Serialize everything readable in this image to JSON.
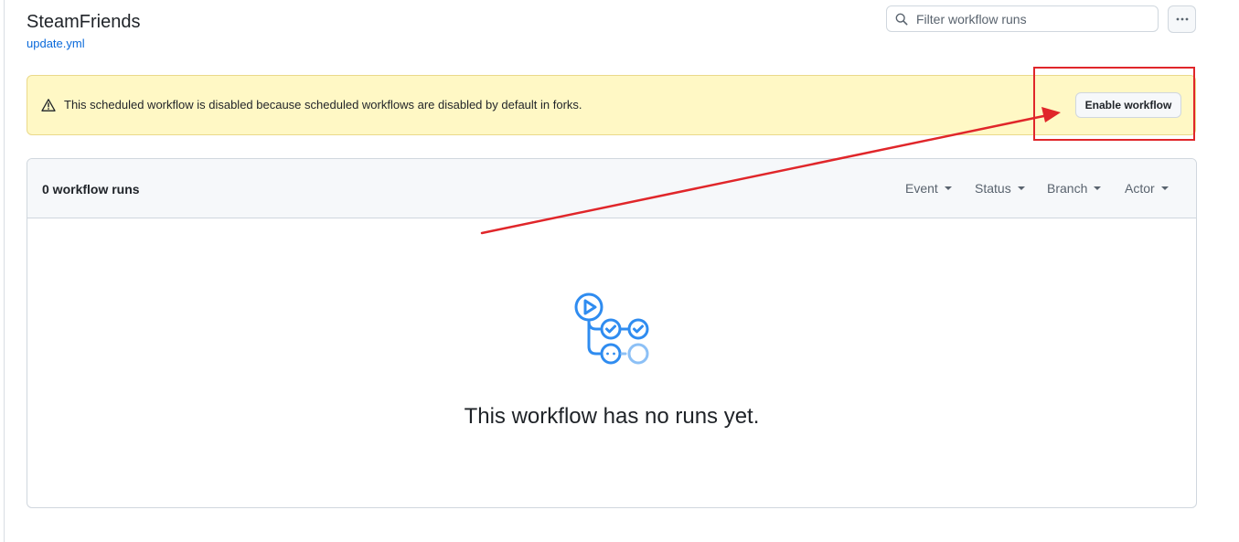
{
  "header": {
    "title": "SteamFriends",
    "file_link": "update.yml"
  },
  "filter": {
    "placeholder": "Filter workflow runs"
  },
  "banner": {
    "message": "This scheduled workflow is disabled because scheduled workflows are disabled by default in forks.",
    "button_label": "Enable workflow"
  },
  "runs": {
    "count_label": "0 workflow runs",
    "filters": [
      "Event",
      "Status",
      "Branch",
      "Actor"
    ],
    "empty_message": "This workflow has no runs yet."
  },
  "icons": {
    "search": "search-icon",
    "more": "kebab-horizontal-icon",
    "alert": "alert-triangle-icon",
    "caret": "triangle-down-icon",
    "empty_state": "workflow-graph-icon"
  },
  "colors": {
    "link": "#0969da",
    "banner_bg": "#fff8c5",
    "annotation": "#e0262a",
    "empty_icon": "#2f8cf0"
  }
}
